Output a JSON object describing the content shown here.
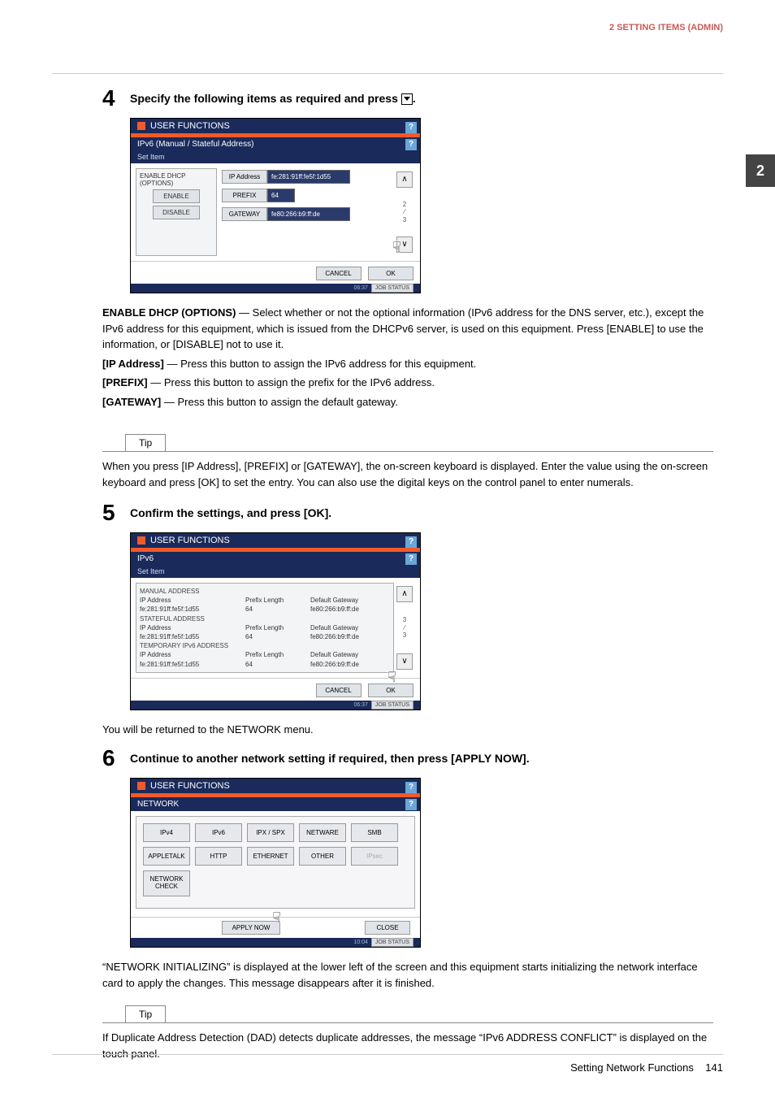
{
  "header": {
    "section": "2 SETTING ITEMS (ADMIN)"
  },
  "side_tab": "2",
  "step4": {
    "num": "4",
    "title_pre": "Specify the following items as required and press ",
    "title_post": ".",
    "panel": {
      "title": "USER FUNCTIONS",
      "sub": "IPv6 (Manual / Stateful Address)",
      "setitem": "Set Item",
      "card_label": "ENABLE DHCP (OPTIONS)",
      "enable": "ENABLE",
      "disable": "DISABLE",
      "ip_label": "IP Address",
      "ip_val": "fe:281:91ff:fe5f:1d55",
      "prefix_label": "PREFIX",
      "prefix_val": "64",
      "gateway_label": "GATEWAY",
      "gateway_val": "fe80:266:b9:ff:de",
      "scroll_ind_top": "2",
      "scroll_ind_bot": "3",
      "cancel": "CANCEL",
      "ok": "OK",
      "time": "06:37",
      "jobstatus": "JOB STATUS"
    },
    "desc_dhcp_label": "ENABLE DHCP (OPTIONS)",
    "desc_dhcp": " — Select whether or not the optional information (IPv6 address for the DNS server, etc.), except the IPv6 address for this equipment, which is issued from the DHCPv6 server, is used on this equipment. Press [ENABLE] to use the information, or [DISABLE] not to use it.",
    "desc_ip_label": "[IP Address]",
    "desc_ip": " — Press this button to assign the IPv6 address for this equipment.",
    "desc_prefix_label": "[PREFIX]",
    "desc_prefix": " — Press this button to assign the prefix for the IPv6 address.",
    "desc_gateway_label": "[GATEWAY]",
    "desc_gateway": " — Press this button to assign the default gateway.",
    "tip_label": "Tip",
    "tip_text": "When you press [IP Address], [PREFIX] or [GATEWAY], the on-screen keyboard is displayed. Enter the value using the on-screen keyboard and press [OK] to set the entry. You can also use the digital keys on the control panel to enter numerals."
  },
  "step5": {
    "num": "5",
    "title": "Confirm the settings, and press [OK].",
    "panel": {
      "title": "USER FUNCTIONS",
      "sub": "IPv6",
      "setitem": "Set Item",
      "sections": [
        {
          "head": "MANUAL ADDRESS",
          "ip_l": "IP Address",
          "ip": "fe:281:91ff:fe5f:1d55",
          "pl_l": "Prefix Length",
          "pl": "64",
          "gw_l": "Default Gateway",
          "gw": "fe80:266:b9:ff:de"
        },
        {
          "head": "STATEFUL ADDRESS",
          "ip_l": "IP Address",
          "ip": "fe:281:91ff:fe5f:1d55",
          "pl_l": "Prefix Length",
          "pl": "64",
          "gw_l": "Default Gateway",
          "gw": "fe80:266:b9:ff:de"
        },
        {
          "head": "TEMPORARY IPv6 ADDRESS",
          "ip_l": "IP Address",
          "ip": "fe:281:91ff:fe5f:1d55",
          "pl_l": "Prefix Length",
          "pl": "64",
          "gw_l": "Default Gateway",
          "gw": "fe80:266:b9:ff:de"
        }
      ],
      "scroll_ind_top": "3",
      "scroll_ind_bot": "3",
      "cancel": "CANCEL",
      "ok": "OK",
      "time": "06:37",
      "jobstatus": "JOB STATUS"
    },
    "after": "You will be returned to the NETWORK menu."
  },
  "step6": {
    "num": "6",
    "title": "Continue to another network setting if required, then press [APPLY NOW].",
    "panel": {
      "title": "USER FUNCTIONS",
      "sub": "NETWORK",
      "btns": [
        "IPv4",
        "IPv6",
        "IPX / SPX",
        "NETWARE",
        "SMB",
        "APPLETALK",
        "HTTP",
        "ETHERNET",
        "OTHER",
        "IPsec",
        "NETWORK CHECK"
      ],
      "apply": "APPLY NOW",
      "close": "CLOSE",
      "time": "10:04",
      "jobstatus": "JOB STATUS"
    },
    "after": "“NETWORK INITIALIZING” is displayed at the lower left of the screen and this equipment starts initializing the network interface card to apply the changes. This message disappears after it is finished.",
    "tip_label": "Tip",
    "tip_text": "If Duplicate Address Detection (DAD) detects duplicate addresses, the message “IPv6 ADDRESS CONFLICT” is displayed on the touch panel."
  },
  "footer": {
    "section": "Setting Network Functions",
    "page": "141"
  }
}
